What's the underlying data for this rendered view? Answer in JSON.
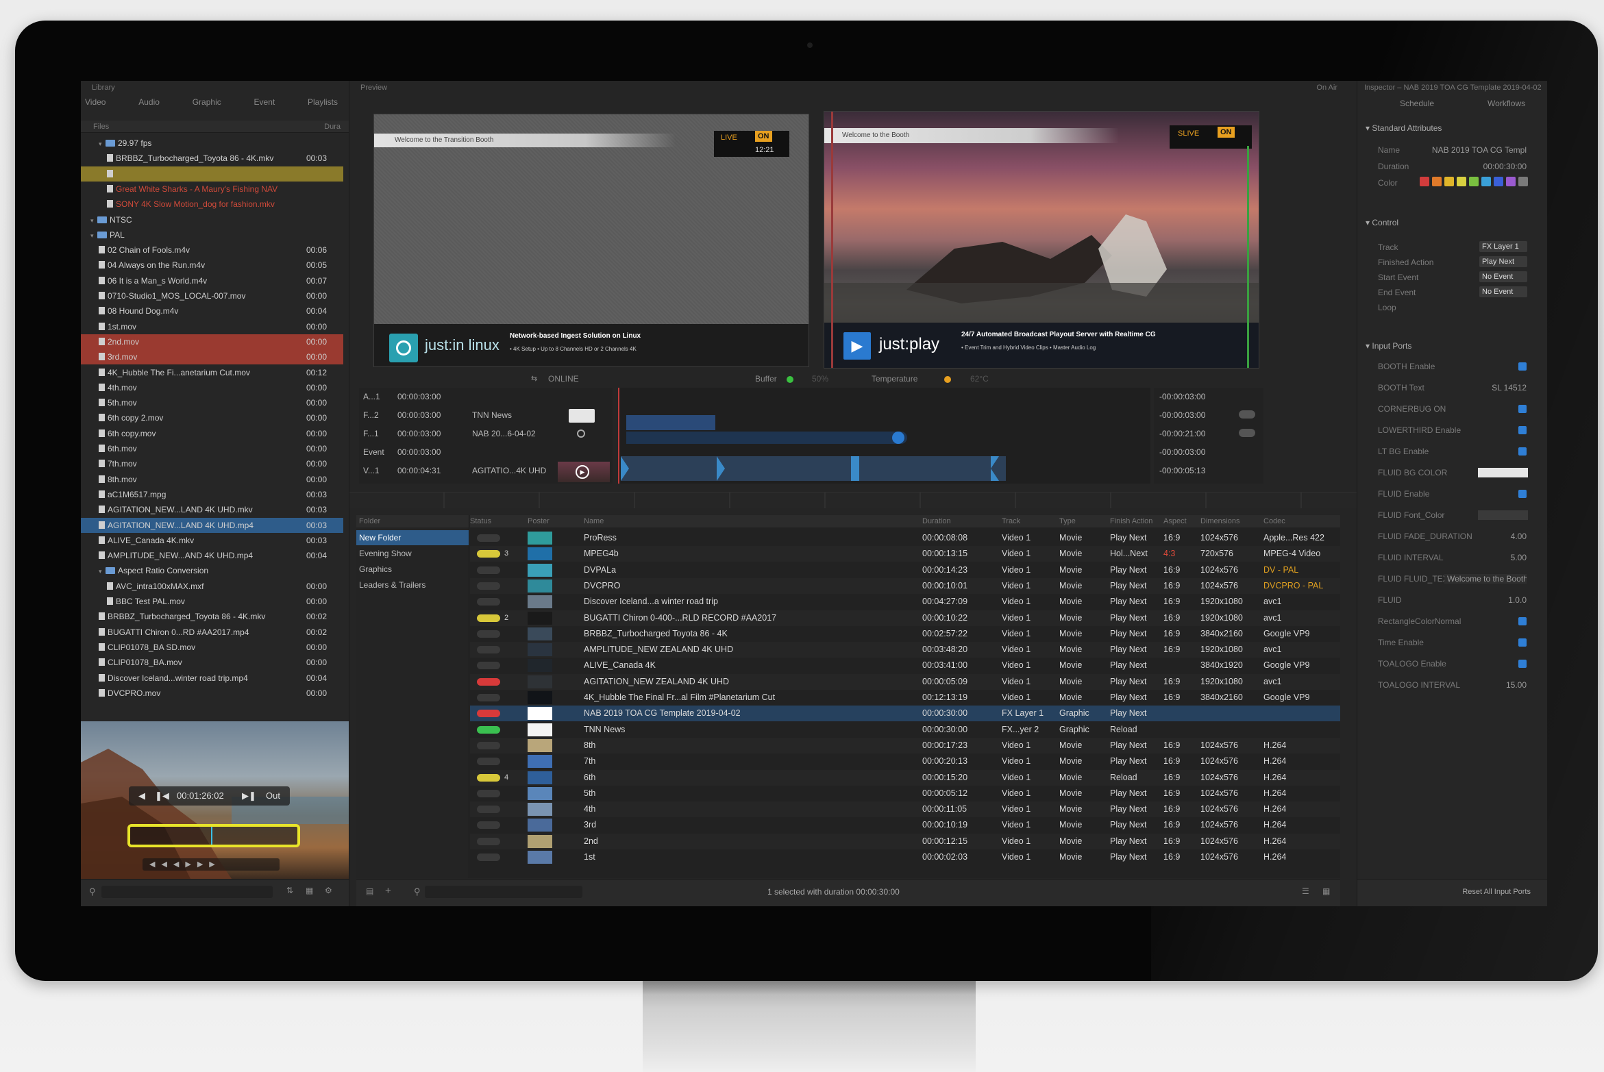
{
  "library": {
    "title": "Library",
    "tabs": [
      "Video",
      "Audio",
      "Graphic",
      "Event",
      "Playlists"
    ],
    "col_files": "Files",
    "col_dur": "Dura",
    "tree": [
      {
        "type": "folder",
        "label": "29.97 fps",
        "dur": "",
        "indent": 1
      },
      {
        "type": "file",
        "label": "BRBBZ_Turbocharged_Toyota 86 - 4K.mkv",
        "dur": "00:03",
        "indent": 2
      },
      {
        "type": "file",
        "label": "",
        "dur": "",
        "indent": 2,
        "state": "yellow"
      },
      {
        "type": "file",
        "label": "Great White Sharks - A Maury's Fishing NAV",
        "dur": "",
        "indent": 2,
        "state": "red-text"
      },
      {
        "type": "file",
        "label": "SONY 4K Slow Motion_dog for fashion.mkv",
        "dur": "",
        "indent": 2,
        "state": "red-text"
      },
      {
        "type": "folder",
        "label": "NTSC",
        "dur": "",
        "indent": 0
      },
      {
        "type": "folder",
        "label": "PAL",
        "dur": "",
        "indent": 0
      },
      {
        "type": "file",
        "label": "02 Chain of Fools.m4v",
        "dur": "00:06",
        "indent": 1
      },
      {
        "type": "file",
        "label": "04 Always on the Run.m4v",
        "dur": "00:05",
        "indent": 1
      },
      {
        "type": "file",
        "label": "06 It is a Man_s World.m4v",
        "dur": "00:07",
        "indent": 1
      },
      {
        "type": "file",
        "label": "0710-Studio1_MOS_LOCAL-007.mov",
        "dur": "00:00",
        "indent": 1
      },
      {
        "type": "file",
        "label": "08 Hound Dog.m4v",
        "dur": "00:04",
        "indent": 1
      },
      {
        "type": "file",
        "label": "1st.mov",
        "dur": "00:00",
        "indent": 1
      },
      {
        "type": "file",
        "label": "2nd.mov",
        "dur": "00:00",
        "indent": 1,
        "state": "red"
      },
      {
        "type": "file",
        "label": "3rd.mov",
        "dur": "00:00",
        "indent": 1,
        "state": "red"
      },
      {
        "type": "file",
        "label": "4K_Hubble The Fi...anetarium Cut.mov",
        "dur": "00:12",
        "indent": 1
      },
      {
        "type": "file",
        "label": "4th.mov",
        "dur": "00:00",
        "indent": 1
      },
      {
        "type": "file",
        "label": "5th.mov",
        "dur": "00:00",
        "indent": 1
      },
      {
        "type": "file",
        "label": "6th copy 2.mov",
        "dur": "00:00",
        "indent": 1
      },
      {
        "type": "file",
        "label": "6th copy.mov",
        "dur": "00:00",
        "indent": 1
      },
      {
        "type": "file",
        "label": "6th.mov",
        "dur": "00:00",
        "indent": 1
      },
      {
        "type": "file",
        "label": "7th.mov",
        "dur": "00:00",
        "indent": 1
      },
      {
        "type": "file",
        "label": "8th.mov",
        "dur": "00:00",
        "indent": 1
      },
      {
        "type": "file",
        "label": "aC1M6517.mpg",
        "dur": "00:03",
        "indent": 1
      },
      {
        "type": "file",
        "label": "AGITATION_NEW...LAND 4K UHD.mkv",
        "dur": "00:03",
        "indent": 1
      },
      {
        "type": "file",
        "label": "AGITATION_NEW...LAND 4K UHD.mp4",
        "dur": "00:03",
        "indent": 1,
        "state": "selected"
      },
      {
        "type": "file",
        "label": "ALIVE_Canada 4K.mkv",
        "dur": "00:03",
        "indent": 1
      },
      {
        "type": "file",
        "label": "AMPLITUDE_NEW...AND 4K UHD.mp4",
        "dur": "00:04",
        "indent": 1
      },
      {
        "type": "folder",
        "label": "Aspect Ratio Conversion",
        "dur": "",
        "indent": 1
      },
      {
        "type": "file",
        "label": "AVC_intra100xMAX.mxf",
        "dur": "00:00",
        "indent": 2
      },
      {
        "type": "file",
        "label": "BBC Test PAL.mov",
        "dur": "00:00",
        "indent": 2
      },
      {
        "type": "file",
        "label": "BRBBZ_Turbocharged_Toyota 86 - 4K.mkv",
        "dur": "00:02",
        "indent": 1
      },
      {
        "type": "file",
        "label": "BUGATTI Chiron 0...RD #AA2017.mp4",
        "dur": "00:02",
        "indent": 1
      },
      {
        "type": "file",
        "label": "CLIP01078_BA SD.mov",
        "dur": "00:00",
        "indent": 1
      },
      {
        "type": "file",
        "label": "CLIP01078_BA.mov",
        "dur": "00:00",
        "indent": 1
      },
      {
        "type": "file",
        "label": "Discover Iceland...winter road trip.mp4",
        "dur": "00:04",
        "indent": 1
      },
      {
        "type": "file",
        "label": "DVCPRO.mov",
        "dur": "00:00",
        "indent": 1
      }
    ],
    "preview_timecode": "00:01:26:02",
    "preview_out": "Out",
    "search_icon": "search-icon"
  },
  "preview": {
    "title": "Preview",
    "on_air": "On Air",
    "left_ticker": "Welcome to the Transition Booth",
    "left_badge_live": "LIVE",
    "left_badge_on": "ON",
    "left_badge_time": "12:21",
    "left_logo": "just:in linux",
    "left_headline": "Network-based Ingest Solution on Linux",
    "left_bullets": "• 4K Setup  • Up to 8 Channels HD or 2 Channels 4K ",
    "right_ticker": "Welcome to the Booth",
    "right_badge_live": "SLIVE",
    "right_badge_on": "ON",
    "right_logo": "just:play",
    "right_headline": "24/7 Automated Broadcast Playout Server with Realtime CG",
    "right_bullets": "• Event Trim and Hybrid Video Clips  • Master Audio Log",
    "status_online": "ONLINE",
    "status_buffer_label": "Buffer",
    "status_buffer_value": "50%",
    "status_temp_label": "Temperature",
    "status_temp_value": "62°C"
  },
  "tracks": [
    {
      "label": "A...1",
      "tc": "00:00:03:00",
      "name": "",
      "btn": ""
    },
    {
      "label": "F...2",
      "tc": "00:00:03:00",
      "name": "TNN News",
      "btn": "box"
    },
    {
      "label": "F...1",
      "tc": "00:00:03:00",
      "name": "NAB 20...6-04-02",
      "btn": "circle"
    },
    {
      "label": "Event",
      "tc": "00:00:03:00",
      "name": "",
      "btn": ""
    },
    {
      "label": "V...1",
      "tc": "00:00:04:31",
      "name": "AGITATIO...4K UHD",
      "btn": "play"
    }
  ],
  "remaining": [
    "-00:00:03:00",
    "-00:00:03:00",
    "-00:00:21:00",
    "-00:00:03:00",
    "-00:00:05:13"
  ],
  "folders": {
    "header": "Folder",
    "items": [
      "New Folder",
      "Evening Show",
      "Graphics",
      "Leaders & Trailers"
    ]
  },
  "playlist": {
    "columns": [
      "Status",
      "Poster",
      "Name",
      "Duration",
      "Track",
      "Type",
      "Finish Action",
      "Aspect",
      "Dimensions",
      "Codec"
    ],
    "rows": [
      {
        "badge": "",
        "badge_num": "",
        "name": "ProRess",
        "dur": "00:00:08:08",
        "track": "Video 1",
        "type": "Movie",
        "finish": "Play Next",
        "aspect": "16:9",
        "dim": "1024x576",
        "codec": "Apple...Res 422",
        "thumb": "#2f9c9c"
      },
      {
        "badge": "yellow",
        "badge_num": "3",
        "name": "MPEG4b",
        "dur": "00:00:13:15",
        "track": "Video 1",
        "type": "Movie",
        "finish": "Hol...Next",
        "aspect": "4:3",
        "dim": "720x576",
        "codec": "MPEG-4 Video",
        "thumb": "#1f6fa8"
      },
      {
        "badge": "",
        "badge_num": "",
        "name": "DVPALa",
        "dur": "00:00:14:23",
        "track": "Video 1",
        "type": "Movie",
        "finish": "Play Next",
        "aspect": "16:9",
        "dim": "1024x576",
        "codec": "DV - PAL",
        "thumb": "#3aa0b8"
      },
      {
        "badge": "",
        "badge_num": "",
        "name": "DVCPRO",
        "dur": "00:00:10:01",
        "track": "Video 1",
        "type": "Movie",
        "finish": "Play Next",
        "aspect": "16:9",
        "dim": "1024x576",
        "codec": "DVCPRO - PAL",
        "thumb": "#2f8a9a"
      },
      {
        "badge": "",
        "badge_num": "",
        "name": "Discover Iceland...a winter road trip",
        "dur": "00:04:27:09",
        "track": "Video 1",
        "type": "Movie",
        "finish": "Play Next",
        "aspect": "16:9",
        "dim": "1920x1080",
        "codec": "avc1",
        "thumb": "#6a7a8a"
      },
      {
        "badge": "yellow",
        "badge_num": "2",
        "name": "BUGATTI Chiron 0-400-...RLD RECORD #AA2017",
        "dur": "00:00:10:22",
        "track": "Video 1",
        "type": "Movie",
        "finish": "Play Next",
        "aspect": "16:9",
        "dim": "1920x1080",
        "codec": "avc1",
        "thumb": "#1a1a1a"
      },
      {
        "badge": "",
        "badge_num": "",
        "name": "BRBBZ_Turbocharged Toyota 86 - 4K",
        "dur": "00:02:57:22",
        "track": "Video 1",
        "type": "Movie",
        "finish": "Play Next",
        "aspect": "16:9",
        "dim": "3840x2160",
        "codec": "Google VP9",
        "thumb": "#3a4a5a"
      },
      {
        "badge": "",
        "badge_num": "",
        "name": "AMPLITUDE_NEW ZEALAND 4K UHD",
        "dur": "00:03:48:20",
        "track": "Video 1",
        "type": "Movie",
        "finish": "Play Next",
        "aspect": "16:9",
        "dim": "1920x1080",
        "codec": "avc1",
        "thumb": "#2a3440"
      },
      {
        "badge": "",
        "badge_num": "",
        "name": "ALIVE_Canada 4K",
        "dur": "00:03:41:00",
        "track": "Video 1",
        "type": "Movie",
        "finish": "Play Next",
        "aspect": "",
        "dim": "3840x1920",
        "codec": "Google VP9",
        "thumb": "#20262c"
      },
      {
        "badge": "red",
        "badge_num": "",
        "name": "AGITATION_NEW ZEALAND 4K UHD",
        "dur": "00:00:05:09",
        "track": "Video 1",
        "type": "Movie",
        "finish": "Play Next",
        "aspect": "16:9",
        "dim": "1920x1080",
        "codec": "avc1",
        "thumb": "#2e3236"
      },
      {
        "badge": "",
        "badge_num": "",
        "name": "4K_Hubble The Final Fr...al Film #Planetarium Cut",
        "dur": "00:12:13:19",
        "track": "Video 1",
        "type": "Movie",
        "finish": "Play Next",
        "aspect": "16:9",
        "dim": "3840x2160",
        "codec": "Google VP9",
        "thumb": "#111418"
      },
      {
        "badge": "red",
        "badge_num": "",
        "name": "NAB 2019 TOA CG Template 2019-04-02",
        "dur": "00:00:30:00",
        "track": "FX Layer 1",
        "type": "Graphic",
        "finish": "Play Next",
        "aspect": "",
        "dim": "",
        "codec": "",
        "thumb": "#ffffff",
        "selected": true
      },
      {
        "badge": "green",
        "badge_num": "",
        "name": "TNN News",
        "dur": "00:00:30:00",
        "track": "FX...yer 2",
        "type": "Graphic",
        "finish": "Reload",
        "aspect": "",
        "dim": "",
        "codec": "",
        "thumb": "#f4f4f4"
      },
      {
        "badge": "",
        "badge_num": "",
        "name": "8th",
        "dur": "00:00:17:23",
        "track": "Video 1",
        "type": "Movie",
        "finish": "Play Next",
        "aspect": "16:9",
        "dim": "1024x576",
        "codec": "H.264",
        "thumb": "#b9a67a"
      },
      {
        "badge": "",
        "badge_num": "",
        "name": "7th",
        "dur": "00:00:20:13",
        "track": "Video 1",
        "type": "Movie",
        "finish": "Play Next",
        "aspect": "16:9",
        "dim": "1024x576",
        "codec": "H.264",
        "thumb": "#3f6fb4"
      },
      {
        "badge": "yellow",
        "badge_num": "4",
        "name": "6th",
        "dur": "00:00:15:20",
        "track": "Video 1",
        "type": "Movie",
        "finish": "Reload",
        "aspect": "16:9",
        "dim": "1024x576",
        "codec": "H.264",
        "thumb": "#2f5f9a"
      },
      {
        "badge": "",
        "badge_num": "",
        "name": "5th",
        "dur": "00:00:05:12",
        "track": "Video 1",
        "type": "Movie",
        "finish": "Play Next",
        "aspect": "16:9",
        "dim": "1024x576",
        "codec": "H.264",
        "thumb": "#5a86ba"
      },
      {
        "badge": "",
        "badge_num": "",
        "name": "4th",
        "dur": "00:00:11:05",
        "track": "Video 1",
        "type": "Movie",
        "finish": "Play Next",
        "aspect": "16:9",
        "dim": "1024x576",
        "codec": "H.264",
        "thumb": "#7a94b2"
      },
      {
        "badge": "",
        "badge_num": "",
        "name": "3rd",
        "dur": "00:00:10:19",
        "track": "Video 1",
        "type": "Movie",
        "finish": "Play Next",
        "aspect": "16:9",
        "dim": "1024x576",
        "codec": "H.264",
        "thumb": "#4a6a9a"
      },
      {
        "badge": "",
        "badge_num": "",
        "name": "2nd",
        "dur": "00:00:12:15",
        "track": "Video 1",
        "type": "Movie",
        "finish": "Play Next",
        "aspect": "16:9",
        "dim": "1024x576",
        "codec": "H.264",
        "thumb": "#b0a072"
      },
      {
        "badge": "",
        "badge_num": "",
        "name": "1st",
        "dur": "00:00:02:03",
        "track": "Video 1",
        "type": "Movie",
        "finish": "Play Next",
        "aspect": "16:9",
        "dim": "1024x576",
        "codec": "H.264",
        "thumb": "#5a7aa8"
      }
    ],
    "footer": "1 selected with duration 00:00:30:00"
  },
  "inspector": {
    "title": "Inspector – NAB 2019 TOA CG Template 2019-04-02",
    "tabs": [
      "Schedule",
      "Workflows"
    ],
    "standard_header": "Standard Attributes",
    "name_label": "Name",
    "name_value": "NAB 2019 TOA CG Templ",
    "duration_label": "Duration",
    "duration_value": "00:00:30:00",
    "color_label": "Color",
    "colors": [
      "#d23c3c",
      "#e07a2a",
      "#e0b52a",
      "#d8d040",
      "#7ac040",
      "#3aa0d8",
      "#3a60d8",
      "#9a5ad0",
      "#7a7a7a"
    ],
    "control_header": "Control",
    "track_label": "Track",
    "track_value": "FX Layer 1",
    "finished_label": "Finished Action",
    "finished_value": "Play Next",
    "start_label": "Start Event",
    "start_value": "No Event",
    "end_label": "End Event",
    "end_value": "No Event",
    "loop_label": "Loop",
    "input_header": "Input Ports",
    "ports": [
      {
        "label": "BOOTH Enable",
        "kind": "check",
        "value": ""
      },
      {
        "label": "BOOTH Text",
        "kind": "text",
        "value": "SL 14512"
      },
      {
        "label": "CORNERBUG ON",
        "kind": "check",
        "value": ""
      },
      {
        "label": "LOWERTHIRD Enable",
        "kind": "check",
        "value": ""
      },
      {
        "label": "LT BG Enable",
        "kind": "check",
        "value": ""
      },
      {
        "label": "FLUID BG COLOR",
        "kind": "bar",
        "value": ""
      },
      {
        "label": "FLUID Enable",
        "kind": "check",
        "value": ""
      },
      {
        "label": "FLUID Font_Color",
        "kind": "darkbar",
        "value": ""
      },
      {
        "label": "FLUID FADE_DURATION",
        "kind": "text",
        "value": "4.00"
      },
      {
        "label": "FLUID INTERVAL",
        "kind": "text",
        "value": "5.00"
      },
      {
        "label": "FLUID FLUID_TEXT",
        "kind": "field",
        "value": "Welcome to the Booth"
      },
      {
        "label": "FLUID",
        "kind": "text",
        "value": "1.0.0"
      },
      {
        "label": "RectangleColorNormal",
        "kind": "check",
        "value": ""
      },
      {
        "label": "Time Enable",
        "kind": "check",
        "value": ""
      },
      {
        "label": "TOALOGO Enable",
        "kind": "check",
        "value": ""
      },
      {
        "label": "TOALOGO INTERVAL",
        "kind": "text",
        "value": "15.00"
      }
    ],
    "reset_button": "Reset All Input Ports"
  }
}
